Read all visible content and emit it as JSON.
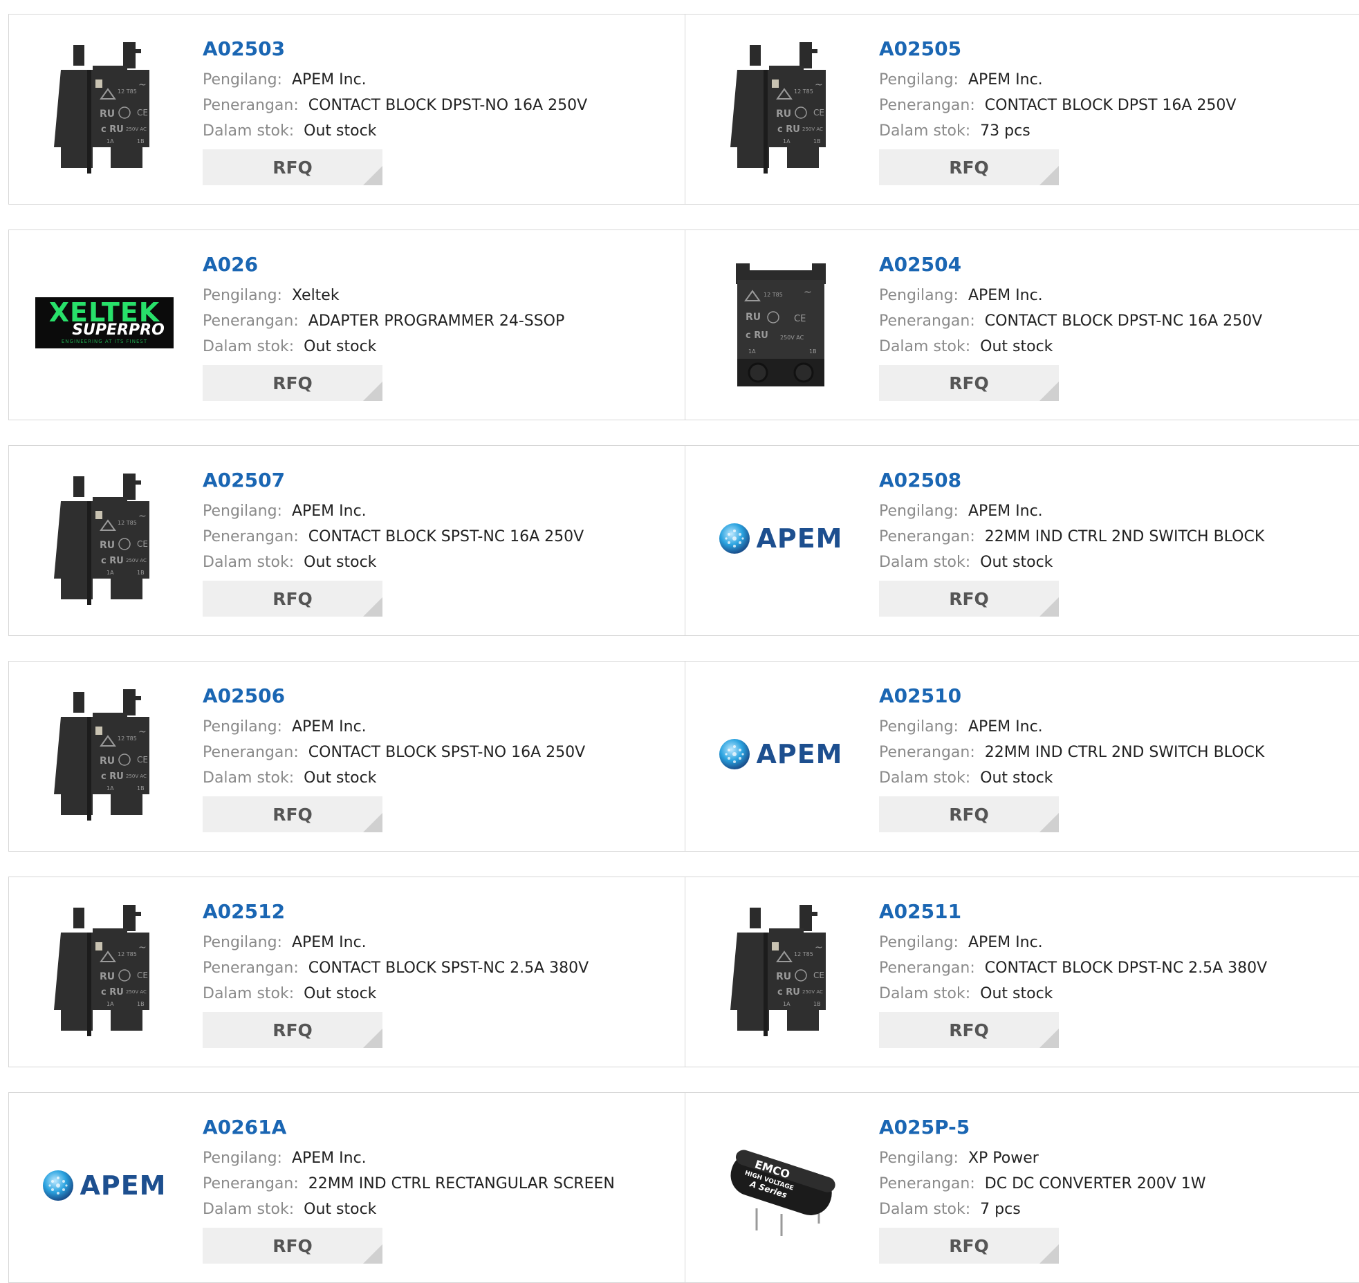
{
  "labels": {
    "manufacturer": "Pengilang:",
    "description": "Penerangan:",
    "stock": "Dalam stok:",
    "rfq": "RFQ"
  },
  "products": [
    {
      "part": "A02503",
      "manufacturer": "APEM Inc.",
      "description": "CONTACT BLOCK DPST-NO 16A 250V",
      "stock": "Out stock",
      "image": "contact-block"
    },
    {
      "part": "A02505",
      "manufacturer": "APEM Inc.",
      "description": "CONTACT BLOCK DPST 16A 250V",
      "stock": "73 pcs",
      "image": "contact-block"
    },
    {
      "part": "A026",
      "manufacturer": "Xeltek",
      "description": "ADAPTER PROGRAMMER 24-SSOP",
      "stock": "Out stock",
      "image": "xeltek-logo"
    },
    {
      "part": "A02504",
      "manufacturer": "APEM Inc.",
      "description": "CONTACT BLOCK DPST-NC 16A 250V",
      "stock": "Out stock",
      "image": "contact-block-front"
    },
    {
      "part": "A02507",
      "manufacturer": "APEM Inc.",
      "description": "CONTACT BLOCK SPST-NC 16A 250V",
      "stock": "Out stock",
      "image": "contact-block"
    },
    {
      "part": "A02508",
      "manufacturer": "APEM Inc.",
      "description": "22MM IND CTRL 2ND SWITCH BLOCK",
      "stock": "Out stock",
      "image": "apem-logo"
    },
    {
      "part": "A02506",
      "manufacturer": "APEM Inc.",
      "description": "CONTACT BLOCK SPST-NO 16A 250V",
      "stock": "Out stock",
      "image": "contact-block"
    },
    {
      "part": "A02510",
      "manufacturer": "APEM Inc.",
      "description": "22MM IND CTRL 2ND SWITCH BLOCK",
      "stock": "Out stock",
      "image": "apem-logo"
    },
    {
      "part": "A02512",
      "manufacturer": "APEM Inc.",
      "description": "CONTACT BLOCK SPST-NC 2.5A 380V",
      "stock": "Out stock",
      "image": "contact-block"
    },
    {
      "part": "A02511",
      "manufacturer": "APEM Inc.",
      "description": "CONTACT BLOCK DPST-NC 2.5A 380V",
      "stock": "Out stock",
      "image": "contact-block"
    },
    {
      "part": "A0261A",
      "manufacturer": "APEM Inc.",
      "description": "22MM IND CTRL RECTANGULAR SCREEN",
      "stock": "Out stock",
      "image": "apem-logo"
    },
    {
      "part": "A025P-5",
      "manufacturer": "XP Power",
      "description": "DC DC CONVERTER 200V 1W",
      "stock": "7 pcs",
      "image": "emco-module"
    }
  ],
  "logos": {
    "xeltek": {
      "top": "XELTEK",
      "middle": "SUPERPRO",
      "tag": "ENGINEERING AT ITS FINEST"
    },
    "apem": "APEM",
    "emco": {
      "line1": "EMCO",
      "line2": "HIGH VOLTAGE",
      "line3": "A Series"
    }
  },
  "colors": {
    "part_link": "#1a66b3",
    "label": "#8a8a8a",
    "rfq_bg": "#efefef",
    "apem_blue": "#1d4f8f",
    "xeltek_green": "#28e06a"
  }
}
